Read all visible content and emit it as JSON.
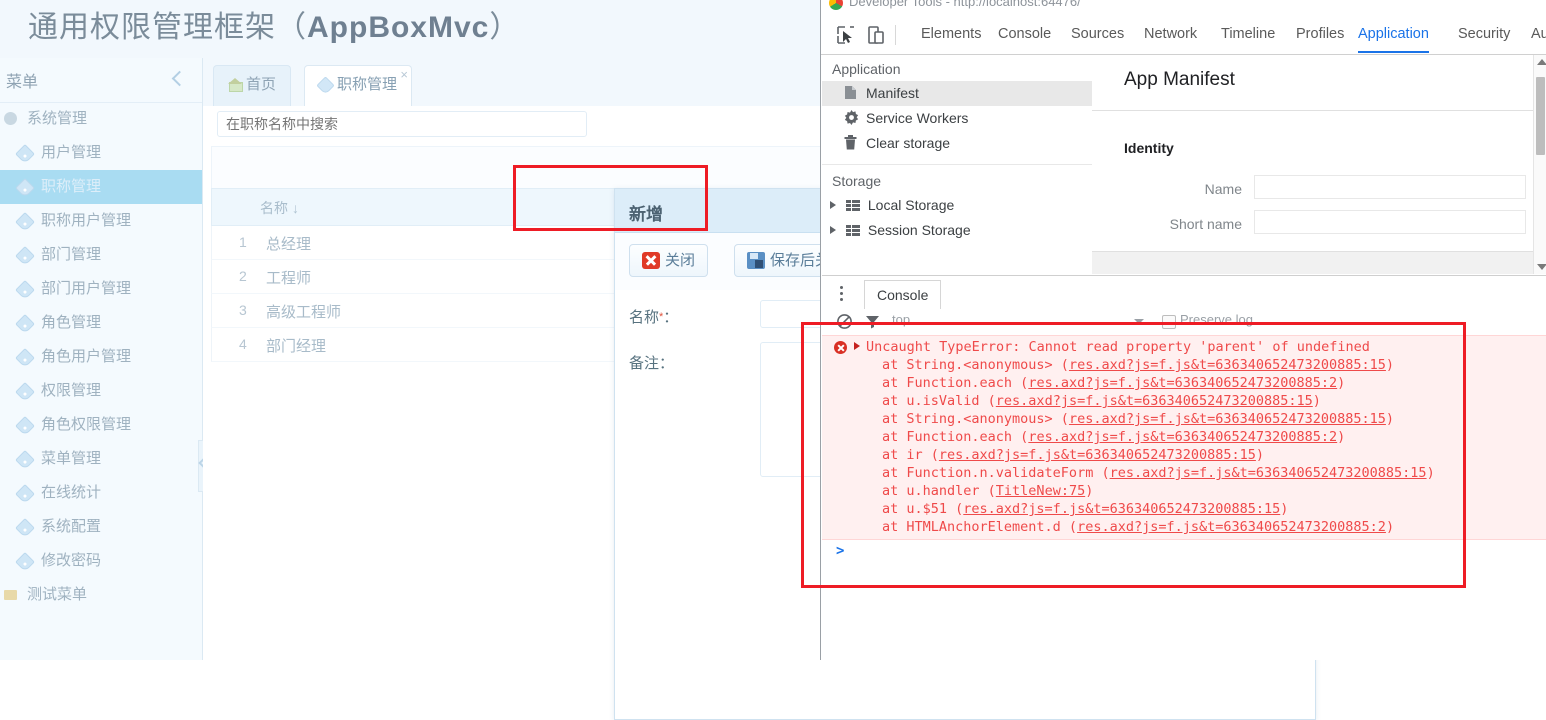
{
  "app": {
    "title_cn": "通用权限管理框架（",
    "title_en": "AppBoxMvc",
    "title_tail": "）",
    "sidebar": {
      "header_label": "菜单",
      "collapse_icon": "chevron-left-icon",
      "items": [
        {
          "label": "系统管理",
          "icon": "globe-icon",
          "type": "group",
          "active": false
        },
        {
          "label": "用户管理",
          "icon": "tag-icon",
          "type": "item",
          "active": false
        },
        {
          "label": "职称管理",
          "icon": "tag-icon",
          "type": "item",
          "active": true
        },
        {
          "label": "职称用户管理",
          "icon": "tag-icon",
          "type": "item",
          "active": false
        },
        {
          "label": "部门管理",
          "icon": "tag-icon",
          "type": "item",
          "active": false
        },
        {
          "label": "部门用户管理",
          "icon": "tag-icon",
          "type": "item",
          "active": false
        },
        {
          "label": "角色管理",
          "icon": "tag-icon",
          "type": "item",
          "active": false
        },
        {
          "label": "角色用户管理",
          "icon": "tag-icon",
          "type": "item",
          "active": false
        },
        {
          "label": "权限管理",
          "icon": "tag-icon",
          "type": "item",
          "active": false
        },
        {
          "label": "角色权限管理",
          "icon": "tag-icon",
          "type": "item",
          "active": false
        },
        {
          "label": "菜单管理",
          "icon": "tag-icon",
          "type": "item",
          "active": false
        },
        {
          "label": "在线统计",
          "icon": "tag-icon",
          "type": "item",
          "active": false
        },
        {
          "label": "系统配置",
          "icon": "tag-icon",
          "type": "item",
          "active": false
        },
        {
          "label": "修改密码",
          "icon": "tag-icon",
          "type": "item",
          "active": false
        },
        {
          "label": "测试菜单",
          "icon": "folder-icon",
          "type": "group",
          "active": false
        }
      ]
    },
    "tabs": [
      {
        "label": "首页",
        "icon": "home-icon",
        "active": false,
        "closable": false
      },
      {
        "label": "职称管理",
        "icon": "tag-icon",
        "active": true,
        "closable": true,
        "close_label": "×"
      }
    ],
    "search": {
      "placeholder": "在职称名称中搜索",
      "value": ""
    },
    "grid": {
      "columns": [
        "名称"
      ],
      "sort_indicator": "↓",
      "rows": [
        {
          "index": "1",
          "name": "总经理"
        },
        {
          "index": "2",
          "name": "工程师"
        },
        {
          "index": "3",
          "name": "高级工程师"
        },
        {
          "index": "4",
          "name": "部门经理"
        }
      ]
    },
    "modal": {
      "title": "新增",
      "buttons": [
        {
          "label": "关闭",
          "icon": "close-red-icon"
        },
        {
          "label": "保存后关闭",
          "icon": "save-disk-icon"
        }
      ],
      "fields": [
        {
          "label": "名称",
          "required_mark": "*",
          "suffix": "：",
          "value": ""
        },
        {
          "label": "备注",
          "required_mark": "",
          "suffix": "：",
          "value": ""
        }
      ]
    }
  },
  "devtools": {
    "window_title": "Developer Tools - http://localhost:64476/",
    "controls": [
      {
        "name": "inspect-element-icon"
      },
      {
        "name": "device-toolbar-icon"
      }
    ],
    "tabs": [
      {
        "label": "Elements",
        "active": false
      },
      {
        "label": "Console",
        "active": false
      },
      {
        "label": "Sources",
        "active": false
      },
      {
        "label": "Network",
        "active": false
      },
      {
        "label": "Timeline",
        "active": false
      },
      {
        "label": "Profiles",
        "active": false
      },
      {
        "label": "Application",
        "active": true
      },
      {
        "label": "Security",
        "active": false
      },
      {
        "label": "Au",
        "active": false
      }
    ],
    "sidebar": {
      "sections": [
        {
          "title": "Application",
          "nodes": [
            {
              "label": "Manifest",
              "icon": "document-icon",
              "selected": true
            },
            {
              "label": "Service Workers",
              "icon": "gear-icon",
              "selected": false
            },
            {
              "label": "Clear storage",
              "icon": "trash-icon",
              "selected": false
            }
          ]
        },
        {
          "title": "Storage",
          "trees": [
            {
              "label": "Local Storage",
              "icon": "table-icon",
              "expanded": false
            },
            {
              "label": "Session Storage",
              "icon": "table-icon",
              "expanded": false
            }
          ]
        }
      ],
      "scrollbar": {
        "up_arrow": "scroll-up-icon",
        "down_arrow": "scroll-down-icon"
      }
    },
    "manifest_panel": {
      "heading": "App Manifest",
      "section_title": "Identity",
      "fields": [
        {
          "label": "Name",
          "value": ""
        },
        {
          "label": "Short name",
          "value": ""
        }
      ]
    },
    "drawer": {
      "kebab_icon": "more-options-icon",
      "tab_label": "Console",
      "clear_icon": "clear-console-icon",
      "filter_icon": "filter-icon",
      "context": "top",
      "context_caret": "chevron-down-icon",
      "preserve_log_label": "Preserve log",
      "preserve_log_checked": false,
      "prompt_glyph": ">"
    },
    "console": {
      "error": {
        "expand_icon": "expand-triangle-icon",
        "status_icon": "error-icon",
        "message": "Uncaught TypeError: Cannot read property 'parent' of undefined",
        "stack": [
          {
            "prefix": "at String.<anonymous> (",
            "link": "res.axd?js=f.js&t=636340652473200885:15",
            "suffix": ")"
          },
          {
            "prefix": "at Function.each (",
            "link": "res.axd?js=f.js&t=636340652473200885:2",
            "suffix": ")"
          },
          {
            "prefix": "at u.isValid (",
            "link": "res.axd?js=f.js&t=636340652473200885:15",
            "suffix": ")"
          },
          {
            "prefix": "at String.<anonymous> (",
            "link": "res.axd?js=f.js&t=636340652473200885:15",
            "suffix": ")"
          },
          {
            "prefix": "at Function.each (",
            "link": "res.axd?js=f.js&t=636340652473200885:2",
            "suffix": ")"
          },
          {
            "prefix": "at ir (",
            "link": "res.axd?js=f.js&t=636340652473200885:15",
            "suffix": ")"
          },
          {
            "prefix": "at Function.n.validateForm (",
            "link": "res.axd?js=f.js&t=636340652473200885:15",
            "suffix": ")"
          },
          {
            "prefix": "at u.handler (",
            "link": "TitleNew:75",
            "suffix": ")"
          },
          {
            "prefix": "at u.$51 (",
            "link": "res.axd?js=f.js&t=636340652473200885:15",
            "suffix": ")"
          },
          {
            "prefix": "at HTMLAnchorElement.d (",
            "link": "res.axd?js=f.js&t=636340652473200885:2",
            "suffix": ")"
          }
        ]
      }
    }
  },
  "annotations": [
    {
      "name": "save-button-highlight",
      "color": "#ee1c25"
    },
    {
      "name": "console-error-highlight",
      "color": "#ee1c25"
    }
  ]
}
